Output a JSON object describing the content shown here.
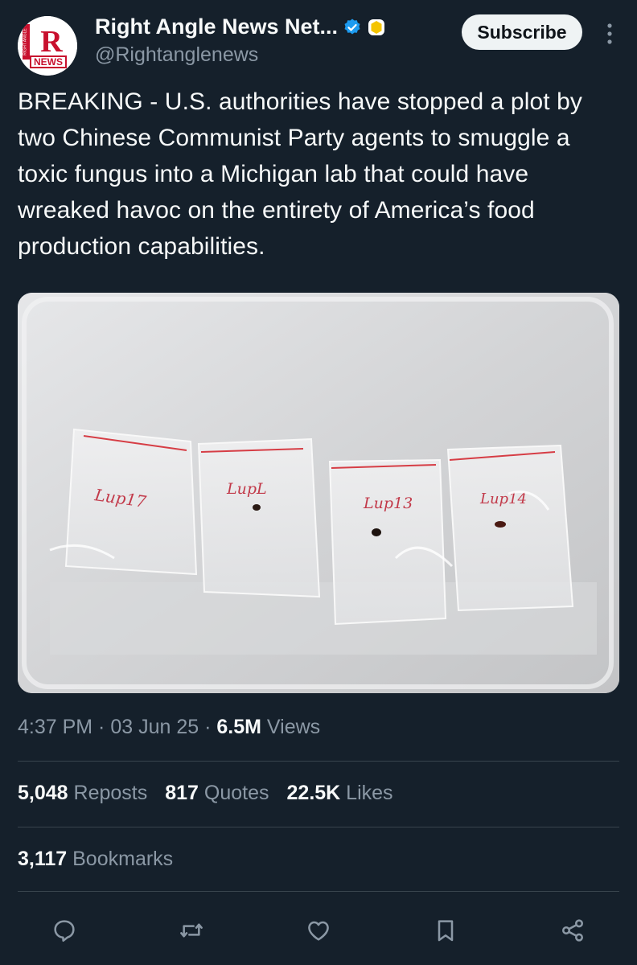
{
  "account": {
    "display_name": "Right Angle News Net...",
    "handle": "@Rightanglenews",
    "avatar_letter": "R",
    "avatar_top_text": "RIGHT ANGLE",
    "avatar_bottom_text": "NEWS",
    "verified_icon": "verified-badge-icon",
    "affiliate_icon": "gold-affiliate-badge-icon"
  },
  "header": {
    "subscribe_label": "Subscribe",
    "more_icon": "more-vertical-icon"
  },
  "tweet": {
    "text": "BREAKING - U.S. authorities have stopped a plot by two Chinese Communist Party agents to smuggle a toxic fungus into a Michigan lab that could have wreaked havoc on the entirety of America’s food production capabilities.",
    "photo_labels": [
      "Lup17",
      "LupL",
      "Lup13",
      "Lup14"
    ]
  },
  "meta": {
    "time": "4:37 PM",
    "sep1": " · ",
    "date": "03 Jun 25",
    "sep2": " · ",
    "views_count": "6.5M",
    "views_label": " Views"
  },
  "stats": {
    "reposts_count": "5,048",
    "reposts_label": " Reposts",
    "quotes_count": "817",
    "quotes_label": " Quotes",
    "likes_count": "22.5K",
    "likes_label": " Likes",
    "bookmarks_count": "3,117",
    "bookmarks_label": " Bookmarks"
  },
  "actions": {
    "reply_icon": "reply-icon",
    "repost_icon": "repost-icon",
    "like_icon": "like-icon",
    "bookmark_icon": "bookmark-icon",
    "share_icon": "share-icon"
  },
  "colors": {
    "background": "#15202b",
    "text_primary": "#f7f9f9",
    "text_secondary": "#8b98a5",
    "divider": "#38444d",
    "verified_blue": "#1d9bf0",
    "affiliate_gold": "#f4c400",
    "brand_red": "#c8102e"
  }
}
